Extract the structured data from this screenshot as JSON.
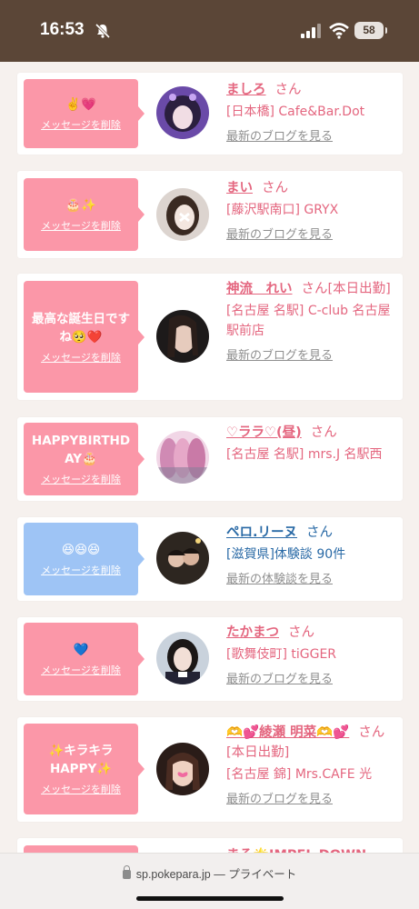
{
  "status": {
    "time": "16:53",
    "battery": "58"
  },
  "url_bar": {
    "domain": "sp.pokepara.jp",
    "mode": "— プライベート"
  },
  "colors": {
    "accent_pink": "#fb97a8",
    "accent_blue": "#9ec4f5",
    "name_pink": "#e4667f",
    "name_blue": "#2a6aa6"
  },
  "delete_label": "メッセージを削除",
  "san": "さん",
  "cards": [
    {
      "message": "✌️💗",
      "name": "ましろ",
      "shop": "[日本橋] Cafe&Bar.Dot",
      "link": "最新のブログを見る"
    },
    {
      "message": "🎂✨",
      "name": "まい",
      "shop": "[藤沢駅南口] GRYX",
      "link": "最新のブログを見る"
    },
    {
      "message": "最高な誕生日ですね🥺❤️",
      "name": "神流　れい",
      "shop": "[名古屋 名駅] C-club 名古屋駅前店",
      "tag": "[本日出勤]",
      "link": "最新のブログを見る"
    },
    {
      "message": "HAPPYBIRTHDAY🎂",
      "name": "♡ララ♡(昼)",
      "shop": "[名古屋 名駅] mrs.J 名駅西",
      "link": ""
    },
    {
      "message": "😆😆😆",
      "name": "ペロ.リーヌ",
      "shop": "[滋賀県]体験談 90件",
      "link": "最新の体験談を見る"
    },
    {
      "message": "💙",
      "name": "たかまつ",
      "shop": "[歌舞伎町] tiGGER",
      "link": "最新のブログを見る"
    },
    {
      "message": "✨キラキラHAPPY✨",
      "name": "🫶💕綾瀬 明菜🫶💕",
      "shop": "[名古屋 錦] Mrs.CAFE 光",
      "tag": "[本日出勤]",
      "link": "最新のブログを見る"
    },
    {
      "message": "",
      "name": "まる🌟IMPEL DOWN",
      "shop": "",
      "link": ""
    }
  ]
}
